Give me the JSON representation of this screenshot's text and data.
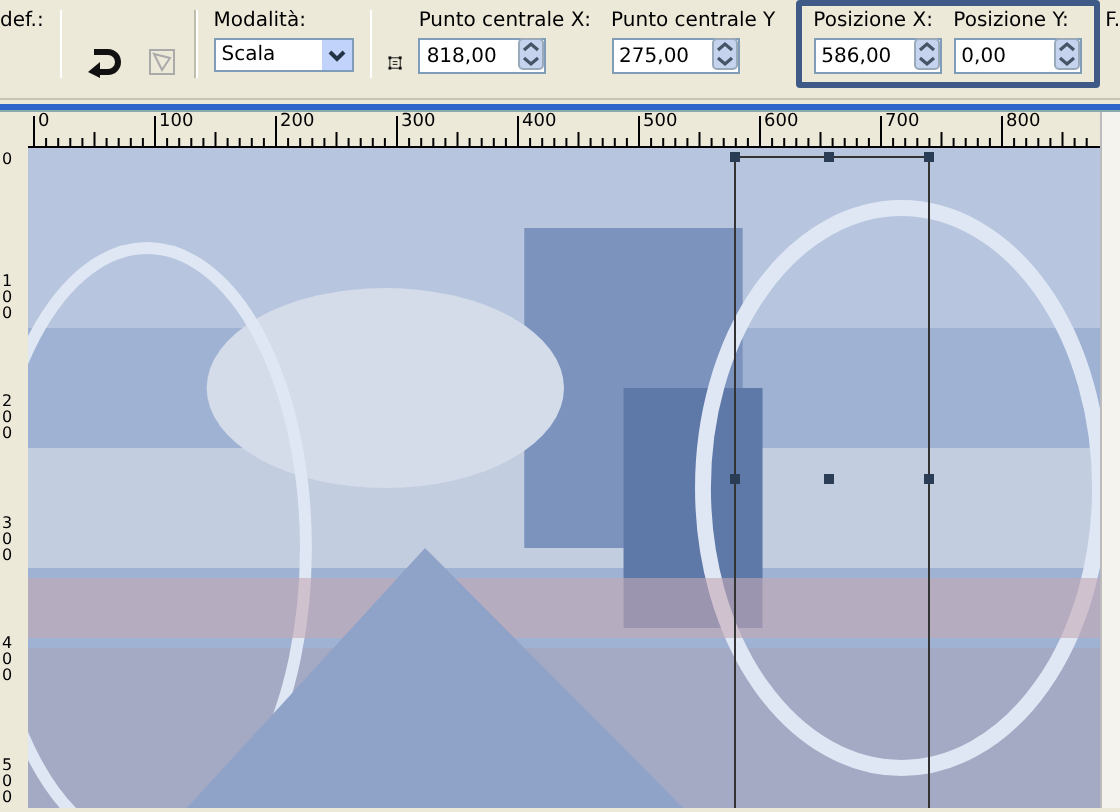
{
  "toolbar": {
    "cut_label": "def.:",
    "mode": {
      "label": "Modalità:",
      "value": "Scala"
    },
    "fields": [
      {
        "label": "Punto centrale X:",
        "value": "818,00",
        "highlighted": false
      },
      {
        "label": "Punto centrale Y",
        "value": "275,00",
        "highlighted": false
      },
      {
        "label": "Posizione X:",
        "value": "586,00",
        "highlighted": true
      },
      {
        "label": "Posizione Y:",
        "value": "0,00",
        "highlighted": true
      }
    ],
    "cut_right_label": "F."
  },
  "ruler_horizontal": [
    "0",
    "100",
    "200",
    "300",
    "400",
    "500",
    "600",
    "700",
    "800"
  ],
  "ruler_vertical": [
    "0",
    "100",
    "200",
    "300",
    "400",
    "500"
  ]
}
